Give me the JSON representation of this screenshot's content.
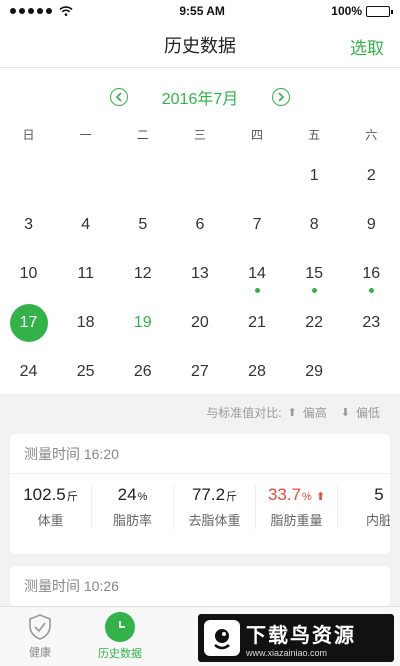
{
  "status_bar": {
    "time": "9:55 AM",
    "battery": "100%"
  },
  "nav": {
    "title": "历史数据",
    "action": "选取"
  },
  "calendar": {
    "month": "2016年7月",
    "weekdays": [
      "日",
      "一",
      "二",
      "三",
      "四",
      "五",
      "六"
    ],
    "days": [
      "1",
      "2",
      "3",
      "4",
      "5",
      "6",
      "7",
      "8",
      "9",
      "10",
      "11",
      "12",
      "13",
      "14",
      "15",
      "16",
      "17",
      "18",
      "19",
      "20",
      "21",
      "22",
      "23",
      "24",
      "25",
      "26",
      "27",
      "28",
      "29"
    ],
    "selected_day": "17",
    "highlighted_day": "19",
    "marked_days": [
      "14",
      "15",
      "16"
    ]
  },
  "legend": {
    "prefix": "与标准值对比:",
    "up": "偏高",
    "down": "偏低"
  },
  "records": [
    {
      "time": "测量时间 16:20",
      "metrics": [
        {
          "value": "102.5",
          "unit": "斤",
          "label": "体重"
        },
        {
          "value": "24",
          "unit": "%",
          "label": "脂肪率"
        },
        {
          "value": "77.2",
          "unit": "斤",
          "label": "去脂体重"
        },
        {
          "value": "33.7",
          "unit": "%",
          "label": "脂肪重量",
          "status": "high"
        },
        {
          "value": "5",
          "unit": "",
          "label": "内脏"
        }
      ]
    },
    {
      "time": "测量时间 10:26"
    }
  ],
  "colors": {
    "accent": "#33b24a",
    "high": "#e04b3a"
  },
  "tabs": [
    {
      "label": "健康",
      "icon": "shield-check-icon"
    },
    {
      "label": "历史数据",
      "icon": "clock-icon"
    }
  ],
  "watermark": {
    "title": "下载鸟资源",
    "url": "www.xiazainiao.com"
  }
}
